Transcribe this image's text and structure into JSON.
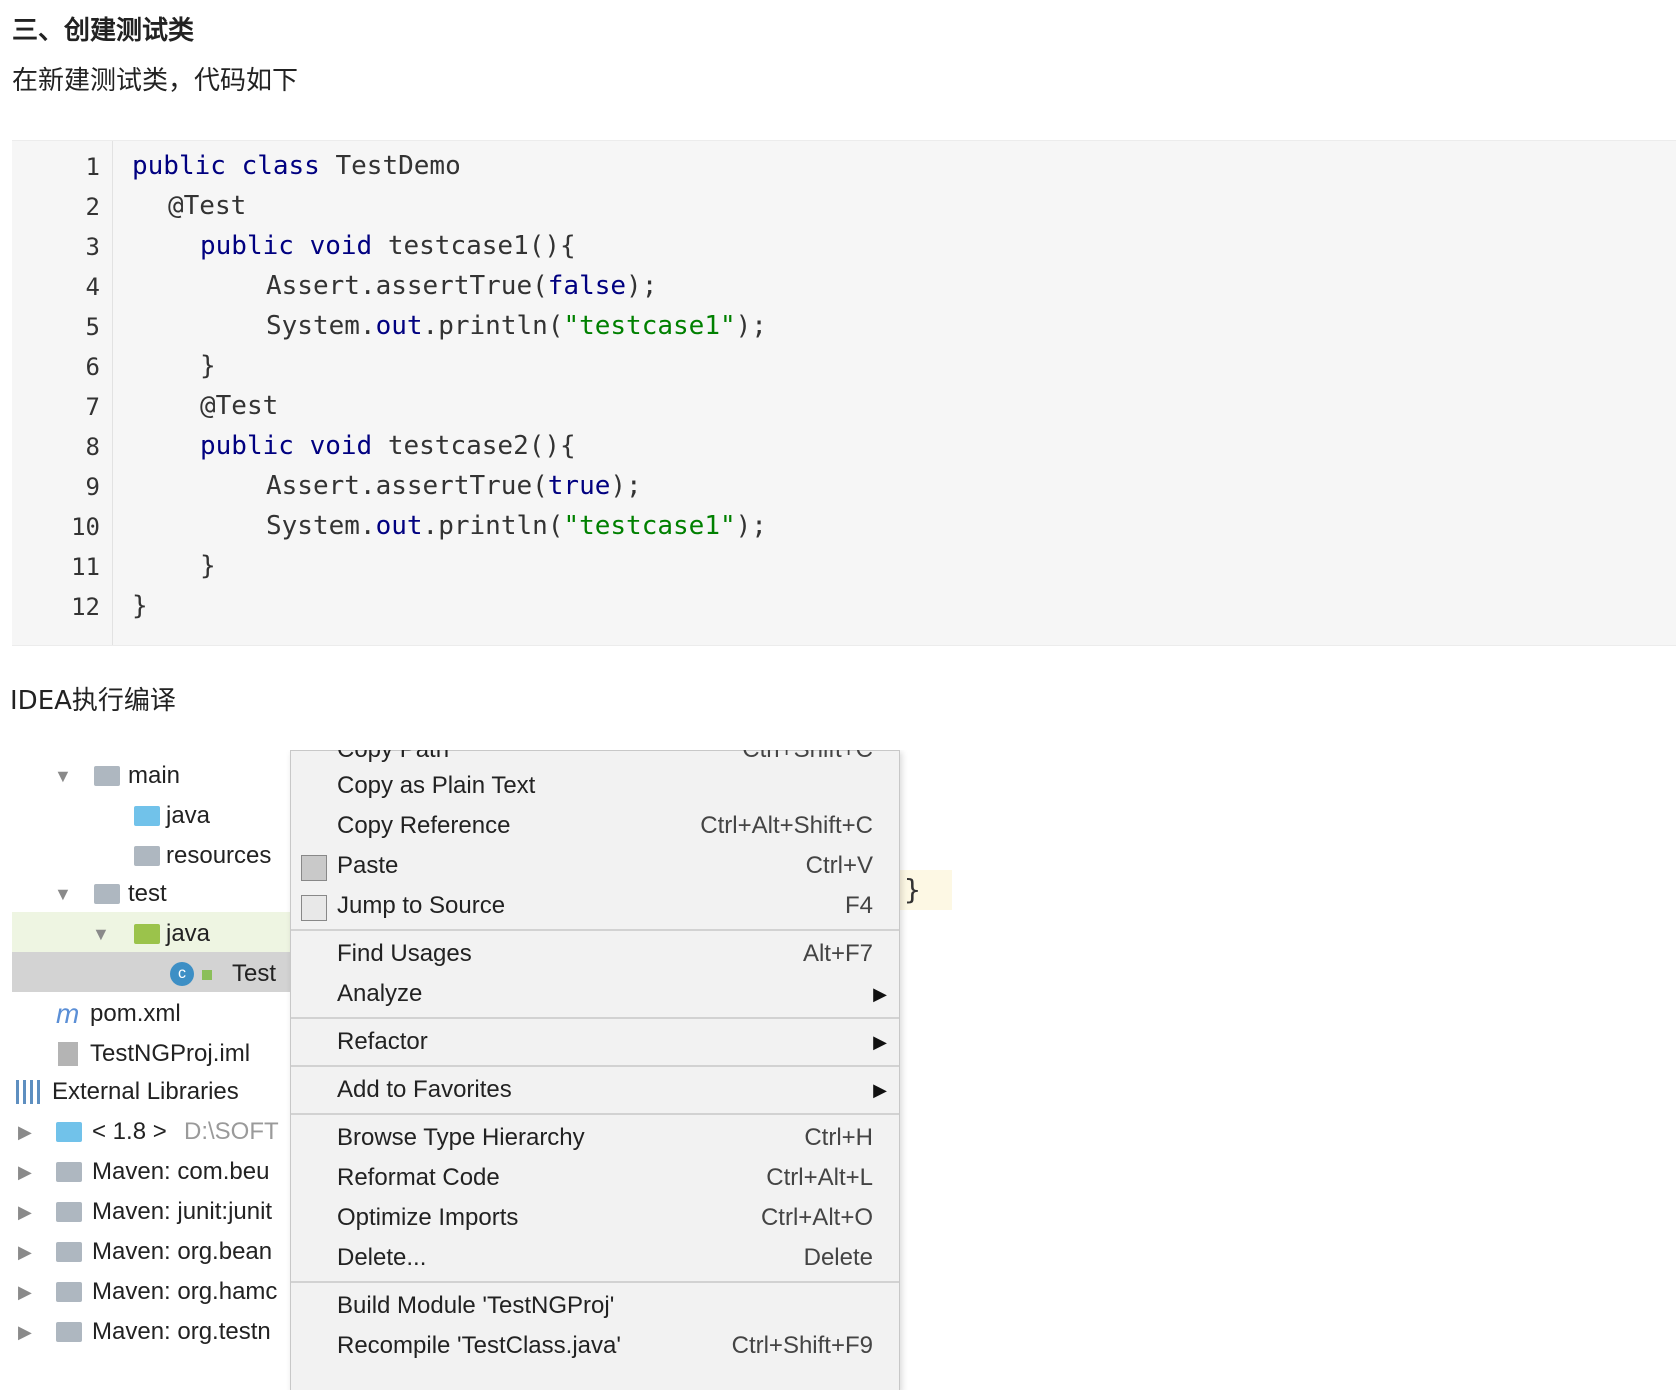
{
  "heading": "三、创建测试类",
  "intro": "在新建测试类，代码如下",
  "code": {
    "line_numbers": [
      "1",
      "2",
      "3",
      "4",
      "5",
      "6",
      "7",
      "8",
      "9",
      "10",
      "11",
      "12"
    ]
  },
  "note": "IDEA执行编译",
  "tree": {
    "main": "main",
    "java1": "java",
    "resources": "resources",
    "test": "test",
    "java2": "java",
    "testclass": "Test",
    "pom": "pom.xml",
    "iml": "TestNGProj.iml",
    "external": "External Libraries",
    "jdk": "< 1.8 >",
    "jdk_path": "D:\\SOFT",
    "libs": [
      "Maven: com.beu",
      "Maven: junit:junit",
      "Maven: org.bean",
      "Maven: org.hamc",
      "Maven: org.testn"
    ]
  },
  "menu": {
    "copy_path": "Copy Path",
    "copy_path_sc": "Ctrl+Shift+C",
    "copy_plain": "Copy as Plain Text",
    "copy_ref": "Copy Reference",
    "copy_ref_sc": "Ctrl+Alt+Shift+C",
    "paste": "Paste",
    "paste_sc": "Ctrl+V",
    "jump": "Jump to Source",
    "jump_sc": "F4",
    "find_usages": "Find Usages",
    "find_usages_sc": "Alt+F7",
    "analyze": "Analyze",
    "refactor": "Refactor",
    "favorites": "Add to Favorites",
    "browse": "Browse Type Hierarchy",
    "browse_sc": "Ctrl+H",
    "reformat": "Reformat Code",
    "reformat_sc": "Ctrl+Alt+L",
    "optimize": "Optimize Imports",
    "optimize_sc": "Ctrl+Alt+O",
    "delete": "Delete...",
    "delete_sc": "Delete",
    "build": "Build Module 'TestNGProj'",
    "recompile": "Recompile 'TestClass.java'",
    "recompile_sc": "Ctrl+Shift+F9"
  },
  "editor_brace": "}"
}
